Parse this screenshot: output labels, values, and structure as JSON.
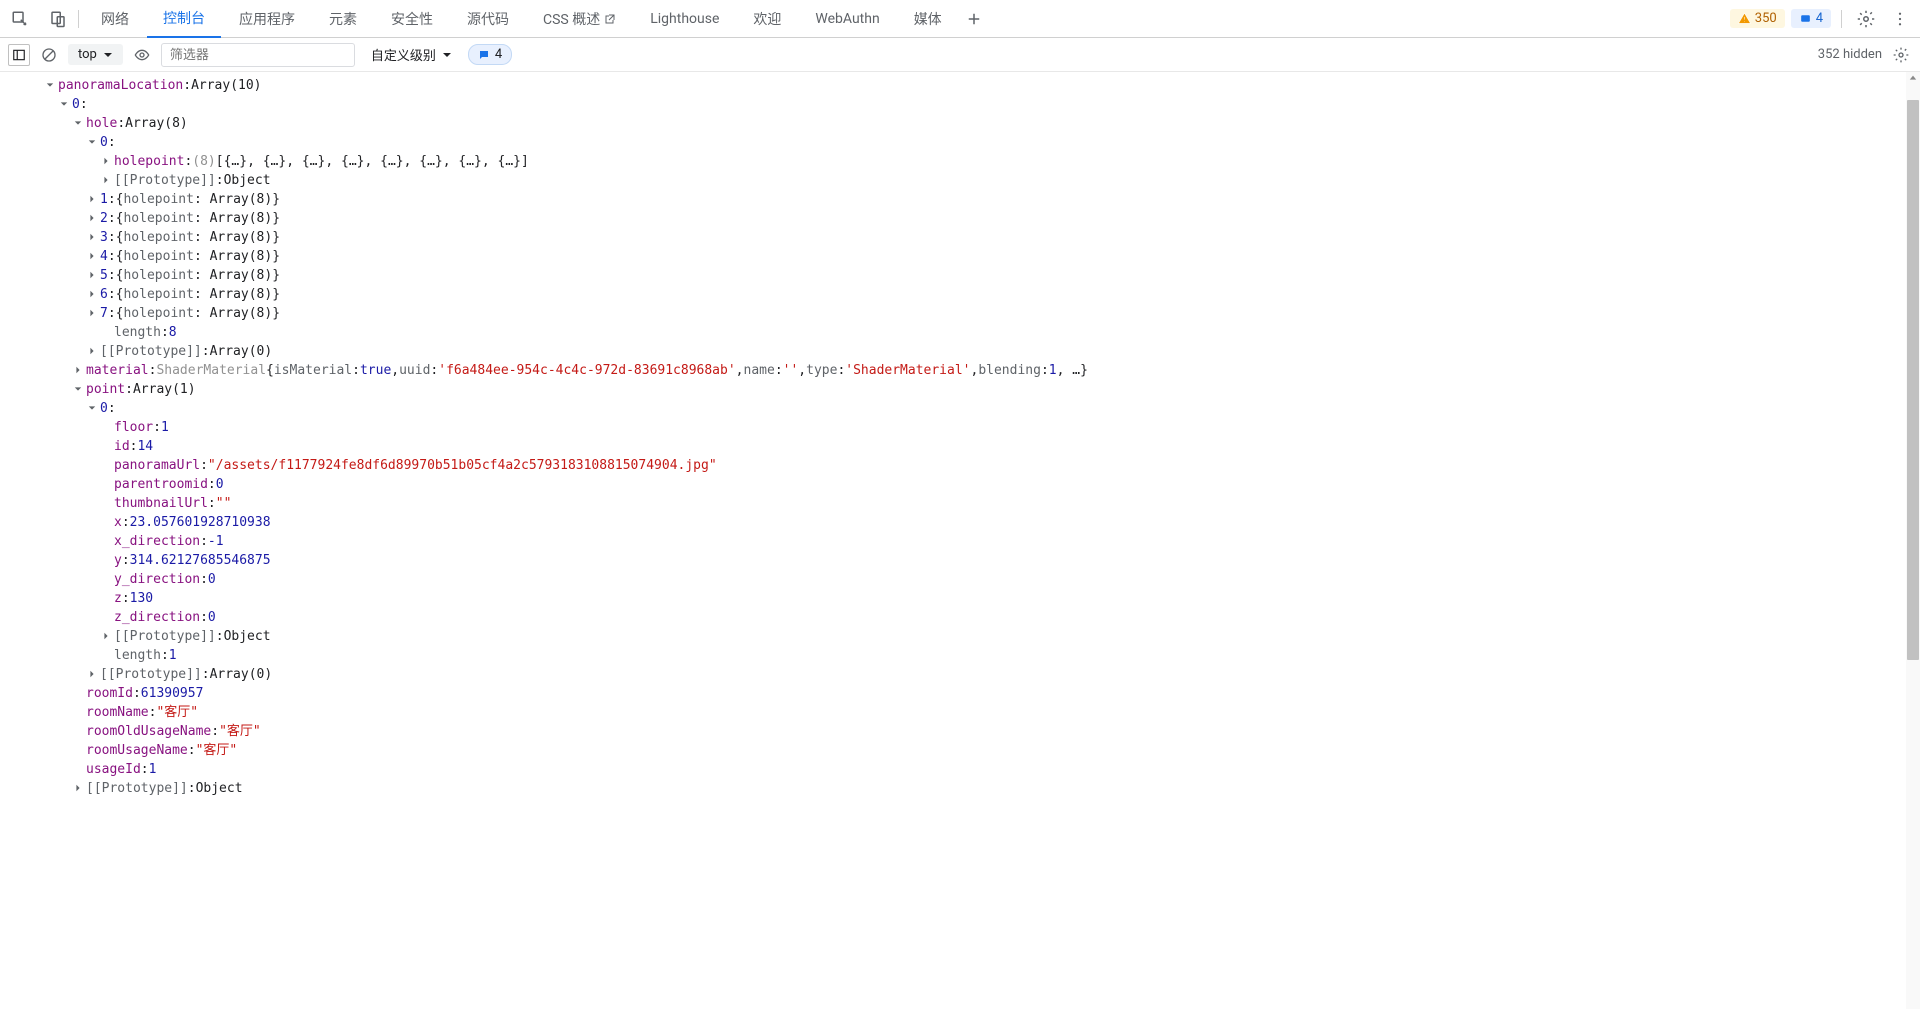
{
  "tabs": {
    "network": "网络",
    "console": "控制台",
    "application": "应用程序",
    "elements": "元素",
    "security": "安全性",
    "sources": "源代码",
    "css": "CSS 概述",
    "lighthouse": "Lighthouse",
    "welcome": "欢迎",
    "webauthn": "WebAuthn",
    "media": "媒体"
  },
  "badges": {
    "warnings": "350",
    "infos": "4"
  },
  "toolbar": {
    "context": "top",
    "filter_placeholder": "筛选器",
    "level": "自定义级别",
    "messages": "4",
    "hidden": "352 hidden"
  },
  "tree": {
    "root_key": "panoramaLocation",
    "root_val": "Array(10)",
    "idx0": "0",
    "hole_key": "hole",
    "hole_val": "Array(8)",
    "hole0": "0",
    "holepoint_key": "holepoint",
    "holepoint_count": "(8) ",
    "holepoint_preview": "[{…}, {…}, {…}, {…}, {…}, {…}, {…}, {…}]",
    "proto_label": "[[Prototype]]",
    "object_word": "Object",
    "hole_items": [
      {
        "idx": "1",
        "key": "holepoint",
        "val": "Array(8)"
      },
      {
        "idx": "2",
        "key": "holepoint",
        "val": "Array(8)"
      },
      {
        "idx": "3",
        "key": "holepoint",
        "val": "Array(8)"
      },
      {
        "idx": "4",
        "key": "holepoint",
        "val": "Array(8)"
      },
      {
        "idx": "5",
        "key": "holepoint",
        "val": "Array(8)"
      },
      {
        "idx": "6",
        "key": "holepoint",
        "val": "Array(8)"
      },
      {
        "idx": "7",
        "key": "holepoint",
        "val": "Array(8)"
      }
    ],
    "length_key": "length",
    "hole_length": "8",
    "array0": "Array(0)",
    "material_key": "material",
    "material_type": "ShaderMaterial",
    "material_preview": "{isMaterial: true, uuid: 'f6a484ee-954c-4c4c-972d-83691c8968ab', name: '', type: 'ShaderMaterial', blending: 1, …}",
    "point_key": "point",
    "point_val": "Array(1)",
    "point0": "0",
    "floor_key": "floor",
    "floor_val": "1",
    "id_key": "id",
    "id_val": "14",
    "panoramaUrl_key": "panoramaUrl",
    "panoramaUrl_val": "\"/assets/f1177924fe8df6d89970b51b05cf4a2c5793183108815074904.jpg\"",
    "parentroomid_key": "parentroomid",
    "parentroomid_val": "0",
    "thumbnailUrl_key": "thumbnailUrl",
    "thumbnailUrl_val": "\"\"",
    "x_key": "x",
    "x_val": "23.057601928710938",
    "x_direction_key": "x_direction",
    "x_direction_val": "-1",
    "y_key": "y",
    "y_val": "314.62127685546875",
    "y_direction_key": "y_direction",
    "y_direction_val": "0",
    "z_key": "z",
    "z_val": "130",
    "z_direction_key": "z_direction",
    "z_direction_val": "0",
    "point_length": "1",
    "roomId_key": "roomId",
    "roomId_val": "61390957",
    "roomName_key": "roomName",
    "roomName_val": "\"客厅\"",
    "roomOldUsageName_key": "roomOldUsageName",
    "roomOldUsageName_val": "\"客厅\"",
    "roomUsageName_key": "roomUsageName",
    "roomUsageName_val": "\"客厅\"",
    "usageId_key": "usageId",
    "usageId_val": "1"
  }
}
